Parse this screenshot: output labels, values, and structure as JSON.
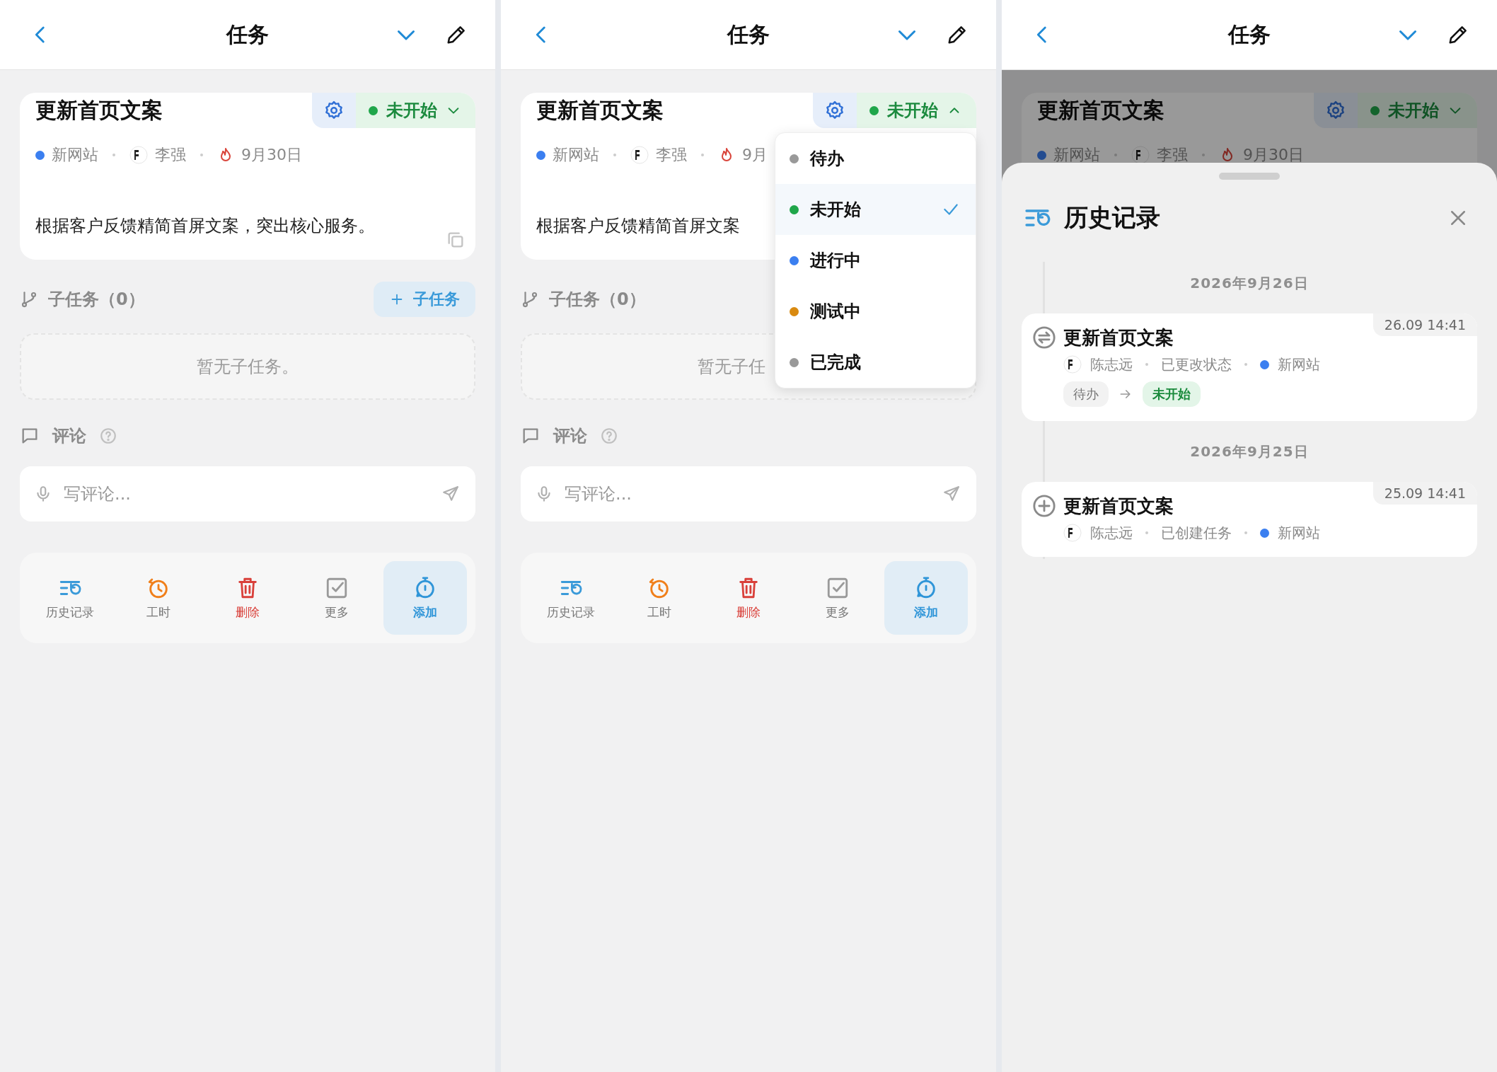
{
  "panels": [
    {
      "header": {
        "title": "任务"
      },
      "task": {
        "title": "更新首页文案",
        "status": {
          "label": "未开始",
          "color": "#1fa64a",
          "expanded": false
        },
        "project": {
          "label": "新网站",
          "color": "#3b7ff0"
        },
        "assignee": "李强",
        "due": "9月30日",
        "description": "根据客户反馈精简首屏文案，突出核心服务。",
        "copyable": true
      },
      "subtasks": {
        "label": "子任务（0）",
        "add_button": "子任务",
        "empty": "暂无子任务。"
      },
      "comments": {
        "label": "评论",
        "placeholder": "写评论..."
      },
      "actions": [
        {
          "kind": "history",
          "label": "历史记录",
          "selected": false
        },
        {
          "kind": "hours",
          "label": "工时",
          "selected": false
        },
        {
          "kind": "delete",
          "label": "删除",
          "selected": false
        },
        {
          "kind": "more",
          "label": "更多",
          "selected": false
        },
        {
          "kind": "add",
          "label": "添加",
          "selected": true
        }
      ]
    },
    {
      "header": {
        "title": "任务"
      },
      "task": {
        "title": "更新首页文案",
        "status": {
          "label": "未开始",
          "color": "#1fa64a",
          "expanded": true
        },
        "project": {
          "label": "新网站",
          "color": "#3b7ff0"
        },
        "assignee": "李强",
        "due": "9月",
        "description": "根据客户反馈精简首屏文案",
        "copyable": false
      },
      "subtasks": {
        "label": "子任务（0）",
        "empty": "暂无子任"
      },
      "comments": {
        "label": "评论",
        "placeholder": "写评论..."
      },
      "actions": [
        {
          "kind": "history",
          "label": "历史记录",
          "selected": false
        },
        {
          "kind": "hours",
          "label": "工时",
          "selected": false
        },
        {
          "kind": "delete",
          "label": "删除",
          "selected": false
        },
        {
          "kind": "more",
          "label": "更多",
          "selected": false
        },
        {
          "kind": "add",
          "label": "添加",
          "selected": true
        }
      ],
      "status_menu": {
        "options": [
          {
            "label": "待办",
            "color": "#999999",
            "selected": false
          },
          {
            "label": "未开始",
            "color": "#1fa64a",
            "selected": true
          },
          {
            "label": "进行中",
            "color": "#3b7ff0",
            "selected": false
          },
          {
            "label": "测试中",
            "color": "#d98a10",
            "selected": false
          },
          {
            "label": "已完成",
            "color": "#999999",
            "selected": false
          }
        ]
      }
    },
    {
      "header": {
        "title": "任务"
      },
      "task": {
        "title": "更新首页文案",
        "status": {
          "label": "未开始",
          "color": "#13642c",
          "expanded": false
        },
        "project": {
          "label": "新网站",
          "color": "#234c90"
        },
        "assignee": "李强",
        "due": "9月30日"
      },
      "history": {
        "title": "历史记录",
        "groups": [
          {
            "date": "2026年9月26日",
            "entries": [
              {
                "kind": "status_change",
                "title": "更新首页文案",
                "time": "26.09 14:41",
                "user": "陈志远",
                "action": "已更改状态",
                "project": {
                  "label": "新网站",
                  "color": "#3b7ff0"
                },
                "change": {
                  "from": "待办",
                  "to": "未开始"
                }
              }
            ]
          },
          {
            "date": "2026年9月25日",
            "entries": [
              {
                "kind": "created",
                "title": "更新首页文案",
                "time": "25.09 14:41",
                "user": "陈志远",
                "action": "已创建任务",
                "project": {
                  "label": "新网站",
                  "color": "#3b7ff0"
                }
              }
            ]
          }
        ]
      }
    }
  ]
}
